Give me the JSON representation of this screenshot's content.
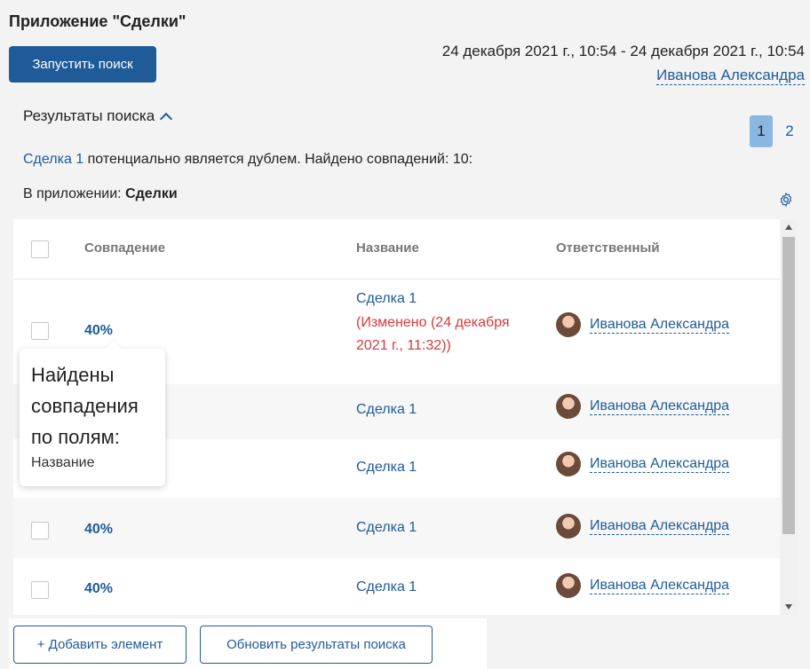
{
  "app_title": "Приложение \"Сделки\"",
  "run_search_label": "Запустить поиск",
  "date_range": "24 декабря 2021 г., 10:54 - 24 декабря 2021 г., 10:54",
  "user_name": "Иванова Александра",
  "results": {
    "title": "Результаты поиска",
    "pages": [
      "1",
      "2"
    ],
    "active_page": "1",
    "duplicate_link": "Сделка 1",
    "duplicate_text": " потенциально является дублем. Найдено совпадений: 10:",
    "in_app_label": "В приложении: ",
    "in_app_name": "Сделки"
  },
  "table": {
    "headers": {
      "match": "Совпадение",
      "name": "Название",
      "responsible": "Ответственный"
    },
    "rows": [
      {
        "match": "40%",
        "name": "Сделка 1",
        "changed": "(Изменено (24 декабря 2021 г., 11:32))",
        "responsible": "Иванова Александра"
      },
      {
        "match": "",
        "name": "Сделка 1",
        "responsible": "Иванова Александра"
      },
      {
        "match": "",
        "name": "Сделка 1",
        "responsible": "Иванова Александра"
      },
      {
        "match": "40%",
        "name": "Сделка 1",
        "responsible": "Иванова Александра"
      },
      {
        "match": "40%",
        "name": "Сделка 1",
        "responsible": "Иванова Александра"
      }
    ]
  },
  "tooltip": {
    "title": "Найдены совпадения по полям:",
    "field": "Название"
  },
  "buttons": {
    "add": "+ Добавить элемент",
    "refresh": "Обновить результаты поиска"
  },
  "colors": {
    "primary": "#1f5b99",
    "changed": "#d63a3a",
    "active_page": "#8ab7e0"
  },
  "icons": {
    "settings": "gear-icon",
    "collapse": "chevron-up-icon"
  }
}
